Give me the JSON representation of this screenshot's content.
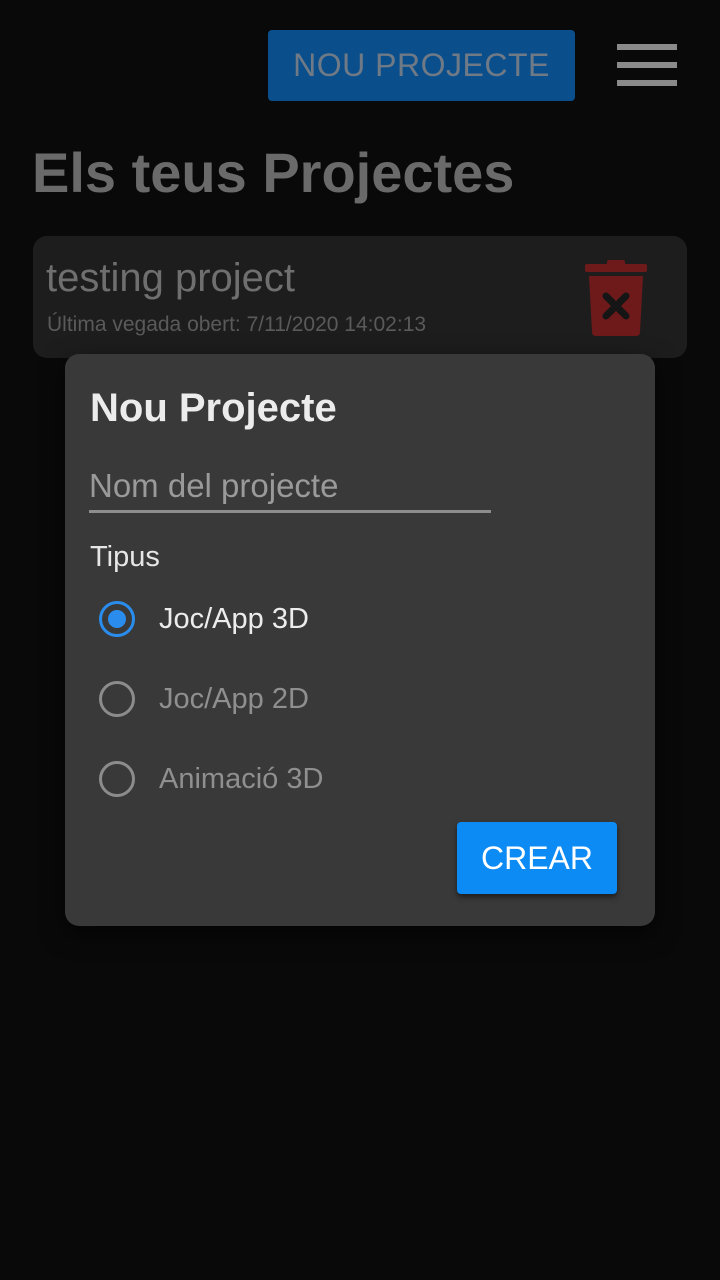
{
  "header": {
    "new_project_label": "NOU PROJECTE",
    "menu_icon": "hamburger-menu-icon"
  },
  "main": {
    "title": "Els teus Projectes",
    "projects": [
      {
        "name": "testing project",
        "last_opened": "Última vegada obert: 7/11/2020 14:02:13",
        "delete_icon": "trash-icon"
      }
    ]
  },
  "dialog": {
    "title": "Nou Projecte",
    "name_input": {
      "value": "",
      "placeholder": "Nom del projecte"
    },
    "type_label": "Tipus",
    "options": [
      {
        "label": "Joc/App 3D",
        "selected": true
      },
      {
        "label": "Joc/App 2D",
        "selected": false
      },
      {
        "label": "Animació 3D",
        "selected": false
      }
    ],
    "create_label": "CREAR"
  },
  "colors": {
    "accent": "#0d8bf5",
    "radio_selected": "#2a8dee",
    "dialog_bg": "#393939",
    "page_bg": "#090909",
    "trash_icon": "#6e1a1a"
  }
}
